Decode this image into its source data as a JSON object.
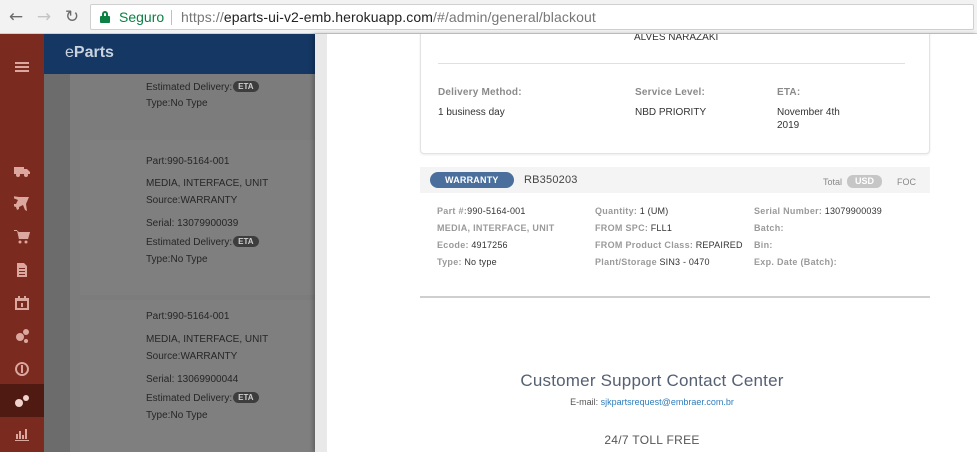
{
  "browser": {
    "secure_label": "Seguro",
    "url_prefix": "https://",
    "url_host": "eparts-ui-v2-emb.herokuapp.com",
    "url_path": "/#/admin/general/blackout"
  },
  "app": {
    "brand_prefix": "e",
    "brand_rest": "Parts",
    "rail_icons": [
      "menu-icon",
      "truck-icon",
      "airplane-icon",
      "cart-icon",
      "document-icon",
      "calendar-icon",
      "gears-icon",
      "dollar-icon",
      "settings-gears-icon",
      "bar-chart-icon"
    ]
  },
  "background_list": {
    "top": {
      "eta_label": "Estimated Delivery:",
      "eta_badge": "ETA",
      "type_label": "Type:",
      "type_value": "No Type"
    },
    "items": [
      {
        "part_label": "Part:",
        "part": "990-5164-001",
        "desc": "MEDIA, INTERFACE, UNIT",
        "source_label": "Source:",
        "source": "WARRANTY",
        "serial_label": "Serial: ",
        "serial": "13079900039",
        "eta_label": "Estimated Delivery:",
        "eta_badge": "ETA",
        "type_label": "Type:",
        "type_value": "No Type"
      },
      {
        "part_label": "Part:",
        "part": "990-5164-001",
        "desc": "MEDIA, INTERFACE, UNIT",
        "source_label": "Source:",
        "source": "WARRANTY",
        "serial_label": "Serial: ",
        "serial": "13069900044",
        "eta_label": "Estimated Delivery:",
        "eta_badge": "ETA",
        "type_label": "Type:",
        "type_value": "No Type"
      }
    ]
  },
  "shipping": {
    "address_line": "ALVES NARAZAKI",
    "delivery_method_label": "Delivery Method:",
    "delivery_method": "1 business day",
    "service_level_label": "Service Level:",
    "service_level": "NBD PRIORITY",
    "eta_label": "ETA:",
    "eta_line1": "November 4th",
    "eta_line2": "2019"
  },
  "item": {
    "badge": "WARRANTY",
    "rb_number": "RB350203",
    "total_label": "Total",
    "currency": "USD",
    "foc": "FOC",
    "part_label": "Part #:",
    "part": "990-5164-001",
    "description": "MEDIA, INTERFACE, UNIT",
    "ecode_label": "Ecode:",
    "ecode": "4917256",
    "type_label": "Type:",
    "type": "No type",
    "quantity_label": "Quantity:",
    "quantity": "1 (UM)",
    "from_spc_label": "FROM SPC:",
    "from_spc": "FLL1",
    "from_class_label": "FROM Product Class:",
    "from_class": "REPAIRED",
    "plant_label": "Plant/Storage",
    "plant": "SIN3 - 0470",
    "serial_label": "Serial Number:",
    "serial": "13079900039",
    "batch_label": "Batch:",
    "bin_label": "Bin:",
    "exp_label": "Exp. Date (Batch):"
  },
  "support": {
    "title": "Customer Support Contact Center",
    "email_label": "E-mail: ",
    "email": "sjkpartsrequest@embraer.com.br",
    "toll_free": "24/7 TOLL FREE"
  },
  "colors": {
    "rail": "#7a2a1e",
    "header": "#153763",
    "warranty_badge": "#4a6f9c",
    "link": "#2f7dbd"
  }
}
